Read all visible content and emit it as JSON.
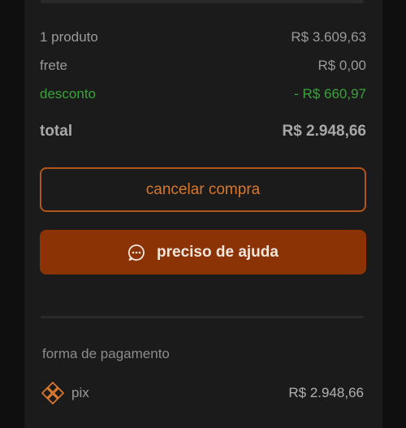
{
  "summary": {
    "items": [
      {
        "label": "1 produto",
        "value": "R$ 3.609,63"
      },
      {
        "label": "frete",
        "value": "R$ 0,00"
      },
      {
        "label": "desconto",
        "value": "- R$ 660,97"
      }
    ],
    "total": {
      "label": "total",
      "value": "R$ 2.948,66"
    }
  },
  "actions": {
    "cancel_label": "cancelar compra",
    "help_label": "preciso de ajuda"
  },
  "payment": {
    "section_label": "forma de pagamento",
    "method": "pix",
    "amount": "R$ 2.948,66",
    "icon": "pix-icon"
  },
  "colors": {
    "accent": "#d8772c",
    "primary_button": "#8c3305",
    "discount": "#3aa33a"
  }
}
